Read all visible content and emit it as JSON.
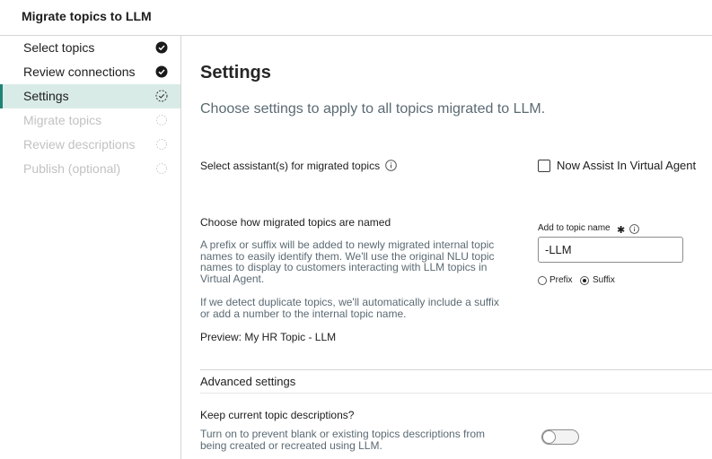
{
  "header": {
    "title": "Migrate topics to LLM"
  },
  "sidebar": {
    "steps": [
      {
        "label": "Select topics",
        "state": "complete"
      },
      {
        "label": "Review connections",
        "state": "complete"
      },
      {
        "label": "Settings",
        "state": "current"
      },
      {
        "label": "Migrate topics",
        "state": "pending"
      },
      {
        "label": "Review descriptions",
        "state": "pending"
      },
      {
        "label": "Publish (optional)",
        "state": "pending"
      }
    ]
  },
  "main": {
    "title": "Settings",
    "subtitle": "Choose settings to apply to all topics migrated to LLM.",
    "assistant": {
      "label": "Select assistant(s) for migrated topics",
      "option_label": "Now Assist In Virtual Agent",
      "checked": false
    },
    "naming": {
      "label": "Choose how migrated topics are named",
      "desc1_lines": [
        "A prefix or suffix will be added to newly migrated internal topic",
        "names to easily identify them. We'll use the original NLU topic",
        "names to display to customers interacting with LLM topics in",
        "Virtual Agent."
      ],
      "desc2_lines": [
        "If we detect duplicate topics, we'll automatically include a suffix",
        "or add a number to the internal topic name."
      ],
      "preview": "Preview: My HR Topic - LLM",
      "field_label": "Add to topic name",
      "field_value": "-LLM",
      "radio_prefix": "Prefix",
      "radio_suffix": "Suffix",
      "selected": "suffix"
    },
    "advanced": {
      "title": "Advanced settings",
      "keep_label": "Keep current topic descriptions?",
      "keep_desc_lines": [
        "Turn on to prevent blank or existing topics descriptions from",
        "being created or recreated using LLM."
      ],
      "toggle_on": false
    }
  },
  "colors": {
    "accent": "#1f8476",
    "active_bg": "#d9ebe7",
    "muted_text": "#5b6a73"
  }
}
